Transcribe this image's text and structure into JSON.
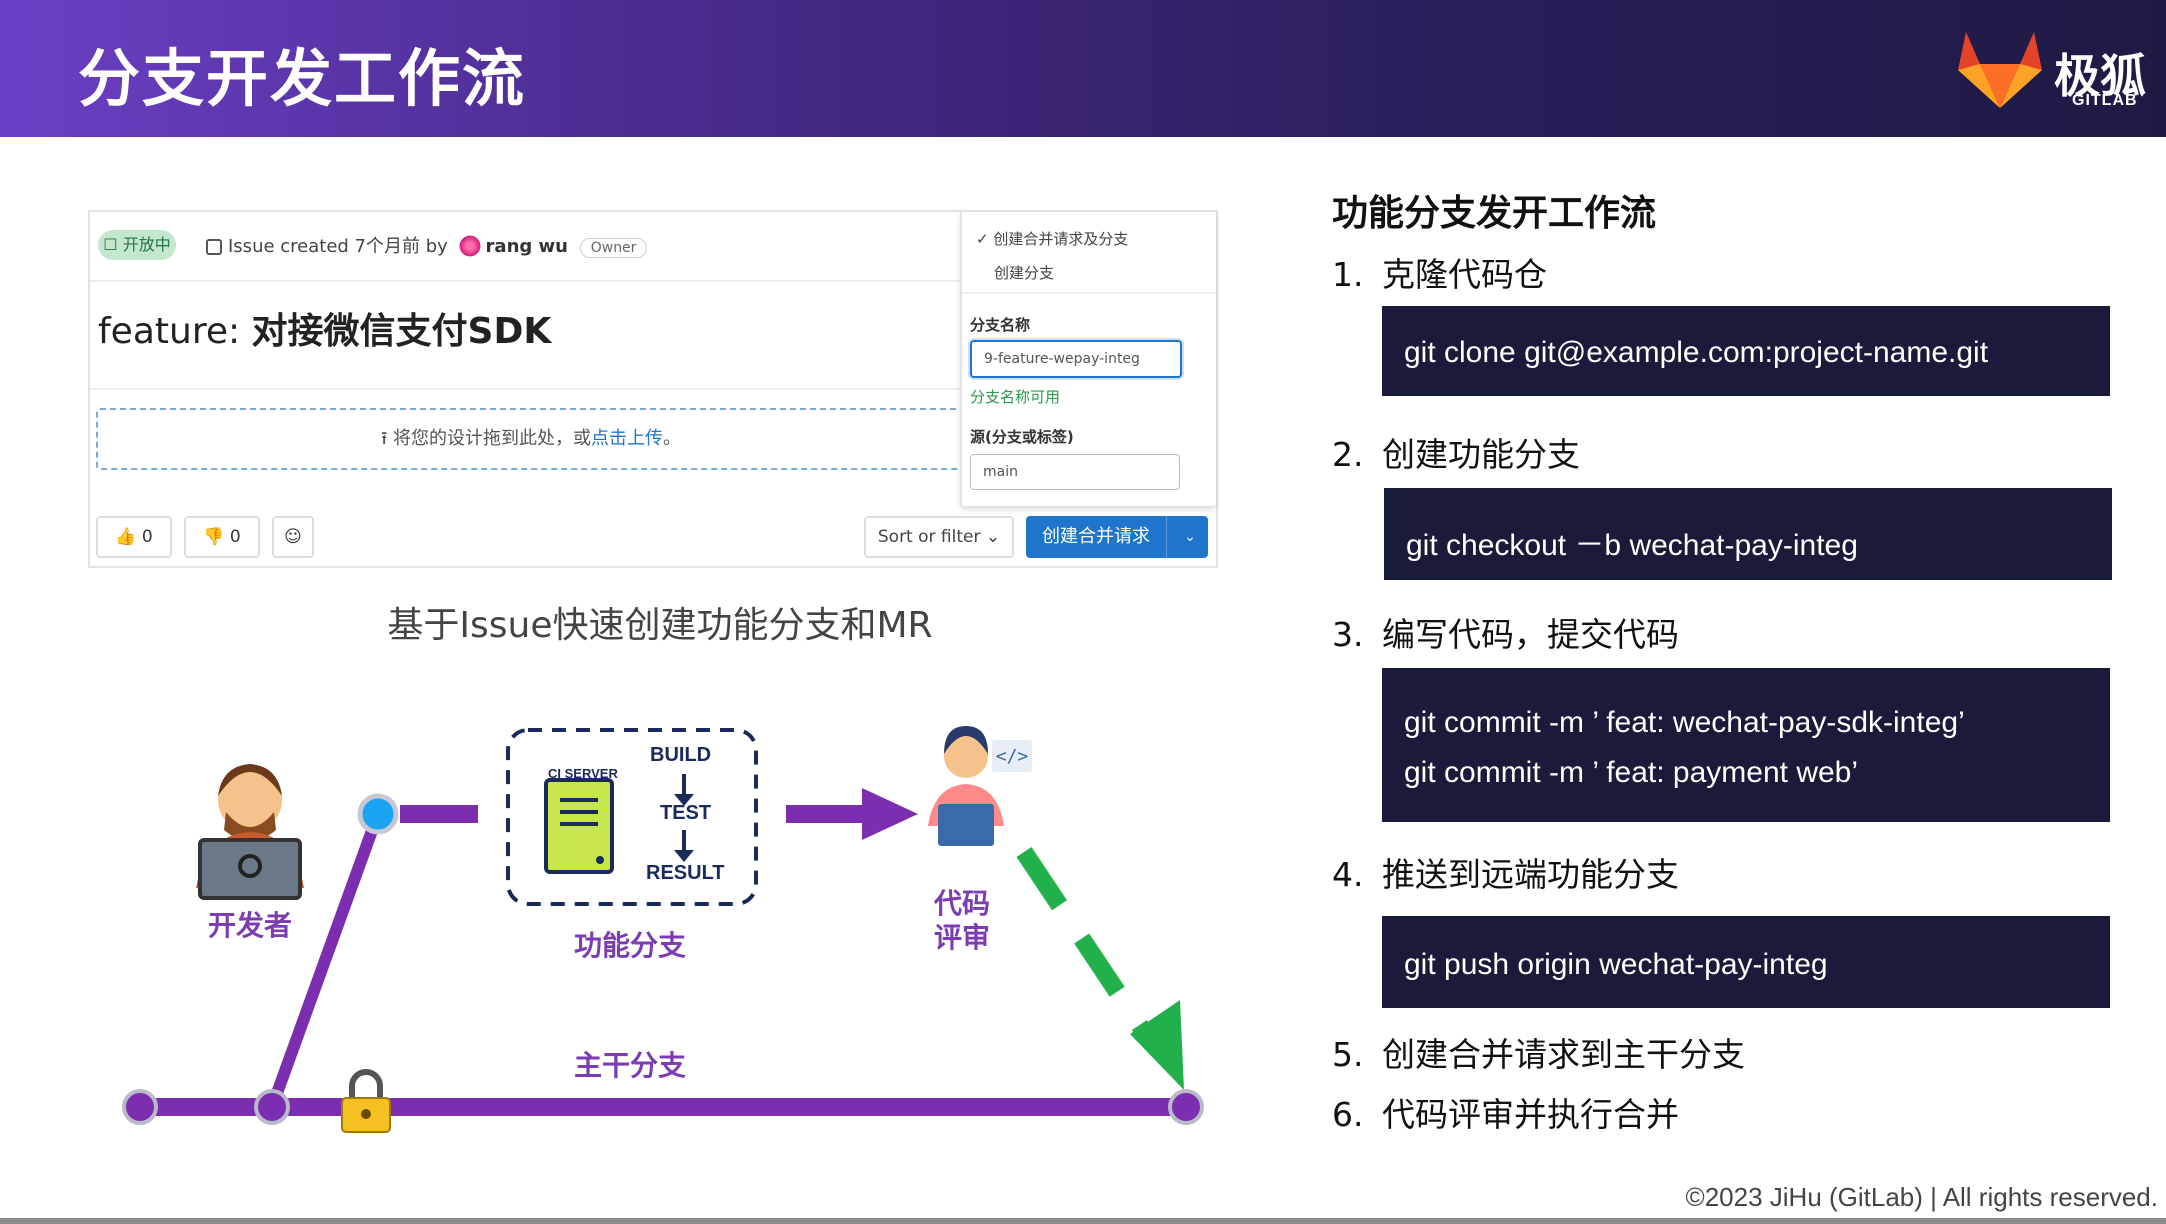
{
  "header": {
    "title": "分支开发工作流",
    "logo_cn": "极狐",
    "logo_en": "GITLAB"
  },
  "issue": {
    "status": "开放中",
    "meta_prefix": "Issue created 7个月前 by",
    "author": "rang wu",
    "role": "Owner",
    "title_prefix": "feature: ",
    "title_main": "对接微信支付SDK",
    "dropzone_text": "将您的设计拖到此处，或",
    "dropzone_link": "点击上传",
    "dropzone_end": "。",
    "thumbs_up": "0",
    "thumbs_down": "0",
    "sort_label": "Sort or filter",
    "mr_button": "创建合并请求",
    "dropdown": {
      "option1": "✓  创建合并请求及分支",
      "option2": "创建分支",
      "branch_label": "分支名称",
      "branch_value": "9-feature-wepay-integ",
      "branch_ok": "分支名称可用",
      "source_label": "源(分支或标签)",
      "source_value": "main"
    }
  },
  "caption": "基于Issue快速创建功能分支和MR",
  "diagram": {
    "developer": "开发者",
    "feature_branch": "功能分支",
    "ci_server": "CI SERVER",
    "build": "BUILD",
    "test": "TEST",
    "result": "RESULT",
    "review_line1": "代码",
    "review_line2": "评审",
    "main_branch": "主干分支",
    "colors": {
      "purple": "#7b2fb0",
      "green": "#22b04a",
      "blue_node": "#1aa3f0"
    }
  },
  "right": {
    "heading": "功能分支发开工作流",
    "steps": [
      {
        "n": "1.",
        "text": "克隆代码仓"
      },
      {
        "n": "2.",
        "text": "创建功能分支"
      },
      {
        "n": "3.",
        "text": "编写代码，提交代码"
      },
      {
        "n": "4.",
        "text": "推送到远端功能分支"
      },
      {
        "n": "5.",
        "text": "创建合并请求到主干分支"
      },
      {
        "n": "6.",
        "text": "代码评审并执行合并"
      }
    ],
    "code": {
      "clone": "git clone git@example.com:project-name.git",
      "checkout": "git checkout  －b wechat-pay-integ",
      "commit1": "git commit -m  ’ feat: wechat-pay-sdk-integ’",
      "commit2": "git commit -m  ’ feat: payment web’",
      "push": "git push origin wechat-pay-integ"
    }
  },
  "footer": {
    "copyright": "©2023 JiHu (GitLab) | All rights reserved."
  }
}
